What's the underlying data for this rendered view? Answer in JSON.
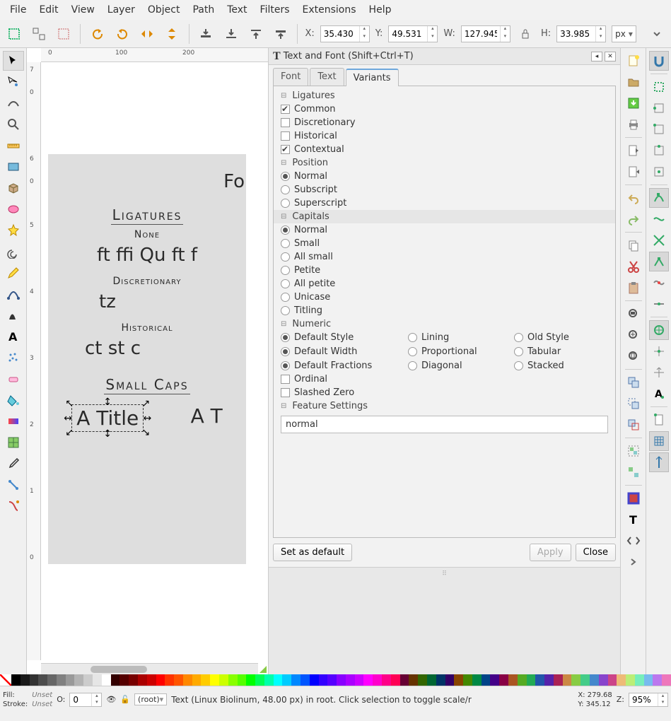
{
  "menu": [
    "File",
    "Edit",
    "View",
    "Layer",
    "Object",
    "Path",
    "Text",
    "Filters",
    "Extensions",
    "Help"
  ],
  "optbar": {
    "x_label": "X:",
    "x": "35.430",
    "y_label": "Y:",
    "y": "49.531",
    "w_label": "W:",
    "w": "127.945",
    "h_label": "H:",
    "h": "33.985",
    "units": "px"
  },
  "ruler_h": {
    "0": "0",
    "100": "100",
    "200": "200"
  },
  "ruler_v": {
    "7": "7",
    "6": "6",
    "5": "5",
    "4": "4",
    "3": "3",
    "2": "2",
    "1": "1",
    "0l": "0",
    "0u": "0",
    "0m": "0"
  },
  "canvas": {
    "title_frag": "Fo",
    "h_ligatures": "Ligatures",
    "sub_none": "None",
    "line_none": "ft  ffi  Qu     ft  f",
    "sub_disc": "Discretionary",
    "line_disc": "tz",
    "sub_hist": "Historical",
    "line_hist": "ct  st           c",
    "h_smallcaps": "Small Caps",
    "sel_text": "A Title",
    "sel_right": "A T"
  },
  "dialog": {
    "title": "Text and Font (Shift+Ctrl+T)",
    "tabs": [
      "Font",
      "Text",
      "Variants"
    ],
    "active_tab": 2,
    "sections": {
      "ligatures": {
        "header": "Ligatures",
        "items": [
          {
            "type": "chk",
            "label": "Common",
            "checked": true
          },
          {
            "type": "chk",
            "label": "Discretionary",
            "checked": false
          },
          {
            "type": "chk",
            "label": "Historical",
            "checked": false
          },
          {
            "type": "chk",
            "label": "Contextual",
            "checked": true
          }
        ]
      },
      "position": {
        "header": "Position",
        "items": [
          {
            "type": "rdo",
            "label": "Normal",
            "checked": true
          },
          {
            "type": "rdo",
            "label": "Subscript",
            "checked": false
          },
          {
            "type": "rdo",
            "label": "Superscript",
            "checked": false
          }
        ]
      },
      "capitals": {
        "header": "Capitals",
        "selected": true,
        "items": [
          {
            "type": "rdo",
            "label": "Normal",
            "checked": true
          },
          {
            "type": "rdo",
            "label": "Small",
            "checked": false
          },
          {
            "type": "rdo",
            "label": "All small",
            "checked": false
          },
          {
            "type": "rdo",
            "label": "Petite",
            "checked": false
          },
          {
            "type": "rdo",
            "label": "All petite",
            "checked": false
          },
          {
            "type": "rdo",
            "label": "Unicase",
            "checked": false
          },
          {
            "type": "rdo",
            "label": "Titling",
            "checked": false
          }
        ]
      },
      "numeric": {
        "header": "Numeric",
        "rows": [
          [
            {
              "label": "Default Style",
              "checked": true
            },
            {
              "label": "Lining",
              "checked": false
            },
            {
              "label": "Old Style",
              "checked": false
            }
          ],
          [
            {
              "label": "Default Width",
              "checked": true
            },
            {
              "label": "Proportional",
              "checked": false
            },
            {
              "label": "Tabular",
              "checked": false
            }
          ],
          [
            {
              "label": "Default Fractions",
              "checked": true
            },
            {
              "label": "Diagonal",
              "checked": false
            },
            {
              "label": "Stacked",
              "checked": false
            }
          ]
        ],
        "extras": [
          {
            "type": "chk",
            "label": "Ordinal",
            "checked": false
          },
          {
            "type": "chk",
            "label": "Slashed Zero",
            "checked": false
          }
        ]
      },
      "feature": {
        "header": "Feature Settings",
        "value": "normal"
      }
    },
    "btn_default": "Set as default",
    "btn_apply": "Apply",
    "btn_close": "Close"
  },
  "status": {
    "fill_label": "Fill:",
    "fill": "Unset",
    "stroke_label": "Stroke:",
    "stroke": "Unset",
    "o_label": "O:",
    "o": "0",
    "layer": "(root)",
    "hint": "Text  (Linux Biolinum, 48.00 px) in root. Click selection to toggle scale/r",
    "x_label": "X:",
    "x": "279.68",
    "y_label": "Y:",
    "y": "345.12",
    "z_label": "Z:",
    "z": "95%"
  },
  "palette": [
    "#000000",
    "#1a1a1a",
    "#333333",
    "#4d4d4d",
    "#666666",
    "#808080",
    "#999999",
    "#b3b3b3",
    "#cccccc",
    "#e6e6e6",
    "#ffffff",
    "#330000",
    "#550000",
    "#770000",
    "#aa0000",
    "#cc0000",
    "#ff0000",
    "#ff3300",
    "#ff5500",
    "#ff8800",
    "#ffaa00",
    "#ffcc00",
    "#ffff00",
    "#ccff00",
    "#88ff00",
    "#55ff00",
    "#00ff00",
    "#00ff55",
    "#00ffaa",
    "#00ffff",
    "#00ccff",
    "#0088ff",
    "#0055ff",
    "#0000ff",
    "#3300ff",
    "#5500ff",
    "#8800ff",
    "#aa00ff",
    "#cc00ff",
    "#ff00ff",
    "#ff00cc",
    "#ff0088",
    "#ff0055",
    "#660033",
    "#663300",
    "#336600",
    "#006633",
    "#003366",
    "#330066",
    "#884400",
    "#448800",
    "#008844",
    "#004488",
    "#440088",
    "#880044",
    "#aa5522",
    "#55aa22",
    "#22aa55",
    "#2255aa",
    "#5522aa",
    "#aa2255",
    "#cc8844",
    "#88cc44",
    "#44cc88",
    "#4488cc",
    "#8844cc",
    "#cc4488",
    "#eebb77",
    "#bbee77",
    "#77eebb",
    "#77bbee",
    "#bb77ee",
    "#ee77bb"
  ]
}
